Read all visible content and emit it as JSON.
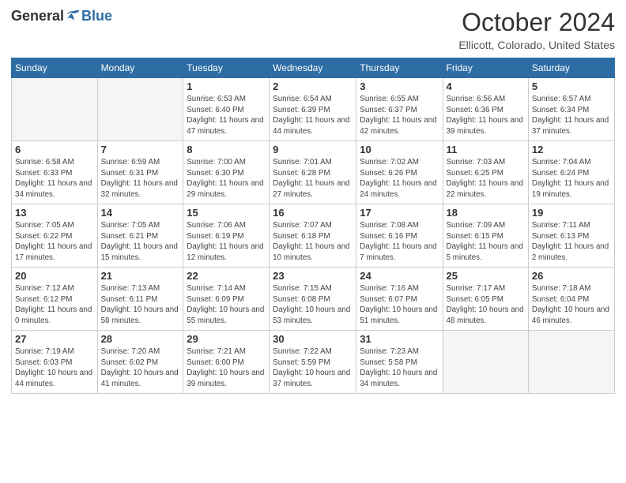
{
  "header": {
    "logo_general": "General",
    "logo_blue": "Blue",
    "month_title": "October 2024",
    "location": "Ellicott, Colorado, United States"
  },
  "days_of_week": [
    "Sunday",
    "Monday",
    "Tuesday",
    "Wednesday",
    "Thursday",
    "Friday",
    "Saturday"
  ],
  "weeks": [
    [
      {
        "day": "",
        "info": ""
      },
      {
        "day": "",
        "info": ""
      },
      {
        "day": "1",
        "info": "Sunrise: 6:53 AM\nSunset: 6:40 PM\nDaylight: 11 hours and 47 minutes."
      },
      {
        "day": "2",
        "info": "Sunrise: 6:54 AM\nSunset: 6:39 PM\nDaylight: 11 hours and 44 minutes."
      },
      {
        "day": "3",
        "info": "Sunrise: 6:55 AM\nSunset: 6:37 PM\nDaylight: 11 hours and 42 minutes."
      },
      {
        "day": "4",
        "info": "Sunrise: 6:56 AM\nSunset: 6:36 PM\nDaylight: 11 hours and 39 minutes."
      },
      {
        "day": "5",
        "info": "Sunrise: 6:57 AM\nSunset: 6:34 PM\nDaylight: 11 hours and 37 minutes."
      }
    ],
    [
      {
        "day": "6",
        "info": "Sunrise: 6:58 AM\nSunset: 6:33 PM\nDaylight: 11 hours and 34 minutes."
      },
      {
        "day": "7",
        "info": "Sunrise: 6:59 AM\nSunset: 6:31 PM\nDaylight: 11 hours and 32 minutes."
      },
      {
        "day": "8",
        "info": "Sunrise: 7:00 AM\nSunset: 6:30 PM\nDaylight: 11 hours and 29 minutes."
      },
      {
        "day": "9",
        "info": "Sunrise: 7:01 AM\nSunset: 6:28 PM\nDaylight: 11 hours and 27 minutes."
      },
      {
        "day": "10",
        "info": "Sunrise: 7:02 AM\nSunset: 6:26 PM\nDaylight: 11 hours and 24 minutes."
      },
      {
        "day": "11",
        "info": "Sunrise: 7:03 AM\nSunset: 6:25 PM\nDaylight: 11 hours and 22 minutes."
      },
      {
        "day": "12",
        "info": "Sunrise: 7:04 AM\nSunset: 6:24 PM\nDaylight: 11 hours and 19 minutes."
      }
    ],
    [
      {
        "day": "13",
        "info": "Sunrise: 7:05 AM\nSunset: 6:22 PM\nDaylight: 11 hours and 17 minutes."
      },
      {
        "day": "14",
        "info": "Sunrise: 7:05 AM\nSunset: 6:21 PM\nDaylight: 11 hours and 15 minutes."
      },
      {
        "day": "15",
        "info": "Sunrise: 7:06 AM\nSunset: 6:19 PM\nDaylight: 11 hours and 12 minutes."
      },
      {
        "day": "16",
        "info": "Sunrise: 7:07 AM\nSunset: 6:18 PM\nDaylight: 11 hours and 10 minutes."
      },
      {
        "day": "17",
        "info": "Sunrise: 7:08 AM\nSunset: 6:16 PM\nDaylight: 11 hours and 7 minutes."
      },
      {
        "day": "18",
        "info": "Sunrise: 7:09 AM\nSunset: 6:15 PM\nDaylight: 11 hours and 5 minutes."
      },
      {
        "day": "19",
        "info": "Sunrise: 7:11 AM\nSunset: 6:13 PM\nDaylight: 11 hours and 2 minutes."
      }
    ],
    [
      {
        "day": "20",
        "info": "Sunrise: 7:12 AM\nSunset: 6:12 PM\nDaylight: 11 hours and 0 minutes."
      },
      {
        "day": "21",
        "info": "Sunrise: 7:13 AM\nSunset: 6:11 PM\nDaylight: 10 hours and 58 minutes."
      },
      {
        "day": "22",
        "info": "Sunrise: 7:14 AM\nSunset: 6:09 PM\nDaylight: 10 hours and 55 minutes."
      },
      {
        "day": "23",
        "info": "Sunrise: 7:15 AM\nSunset: 6:08 PM\nDaylight: 10 hours and 53 minutes."
      },
      {
        "day": "24",
        "info": "Sunrise: 7:16 AM\nSunset: 6:07 PM\nDaylight: 10 hours and 51 minutes."
      },
      {
        "day": "25",
        "info": "Sunrise: 7:17 AM\nSunset: 6:05 PM\nDaylight: 10 hours and 48 minutes."
      },
      {
        "day": "26",
        "info": "Sunrise: 7:18 AM\nSunset: 6:04 PM\nDaylight: 10 hours and 46 minutes."
      }
    ],
    [
      {
        "day": "27",
        "info": "Sunrise: 7:19 AM\nSunset: 6:03 PM\nDaylight: 10 hours and 44 minutes."
      },
      {
        "day": "28",
        "info": "Sunrise: 7:20 AM\nSunset: 6:02 PM\nDaylight: 10 hours and 41 minutes."
      },
      {
        "day": "29",
        "info": "Sunrise: 7:21 AM\nSunset: 6:00 PM\nDaylight: 10 hours and 39 minutes."
      },
      {
        "day": "30",
        "info": "Sunrise: 7:22 AM\nSunset: 5:59 PM\nDaylight: 10 hours and 37 minutes."
      },
      {
        "day": "31",
        "info": "Sunrise: 7:23 AM\nSunset: 5:58 PM\nDaylight: 10 hours and 34 minutes."
      },
      {
        "day": "",
        "info": ""
      },
      {
        "day": "",
        "info": ""
      }
    ]
  ]
}
